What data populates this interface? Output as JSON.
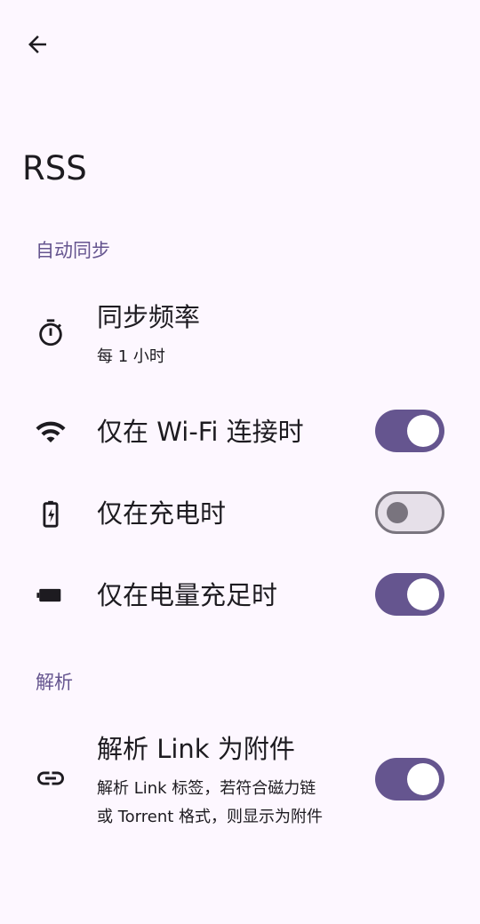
{
  "header": {
    "back_icon": "arrow-back-icon",
    "title": "RSS"
  },
  "sections": [
    {
      "header": "自动同步",
      "items": [
        {
          "icon": "timer-icon",
          "title": "同步频率",
          "subtitle": "每 1 小时"
        },
        {
          "icon": "wifi-icon",
          "title": "仅在 Wi-Fi 连接时",
          "toggle": true
        },
        {
          "icon": "battery-charging-icon",
          "title": "仅在充电时",
          "toggle": false
        },
        {
          "icon": "battery-full-icon",
          "title": "仅在电量充足时",
          "toggle": true
        }
      ]
    },
    {
      "header": "解析",
      "items": [
        {
          "icon": "link-icon",
          "title": "解析 Link 为附件",
          "subtitle_line1": "解析 Link 标签，若符合磁力链",
          "subtitle_line2": "或 Torrent 格式，则显示为附件",
          "toggle": true
        }
      ]
    }
  ],
  "colors": {
    "background": "#fdf7ff",
    "accent": "#65558f",
    "on_surface": "#1d1b20",
    "outline": "#79747e"
  }
}
